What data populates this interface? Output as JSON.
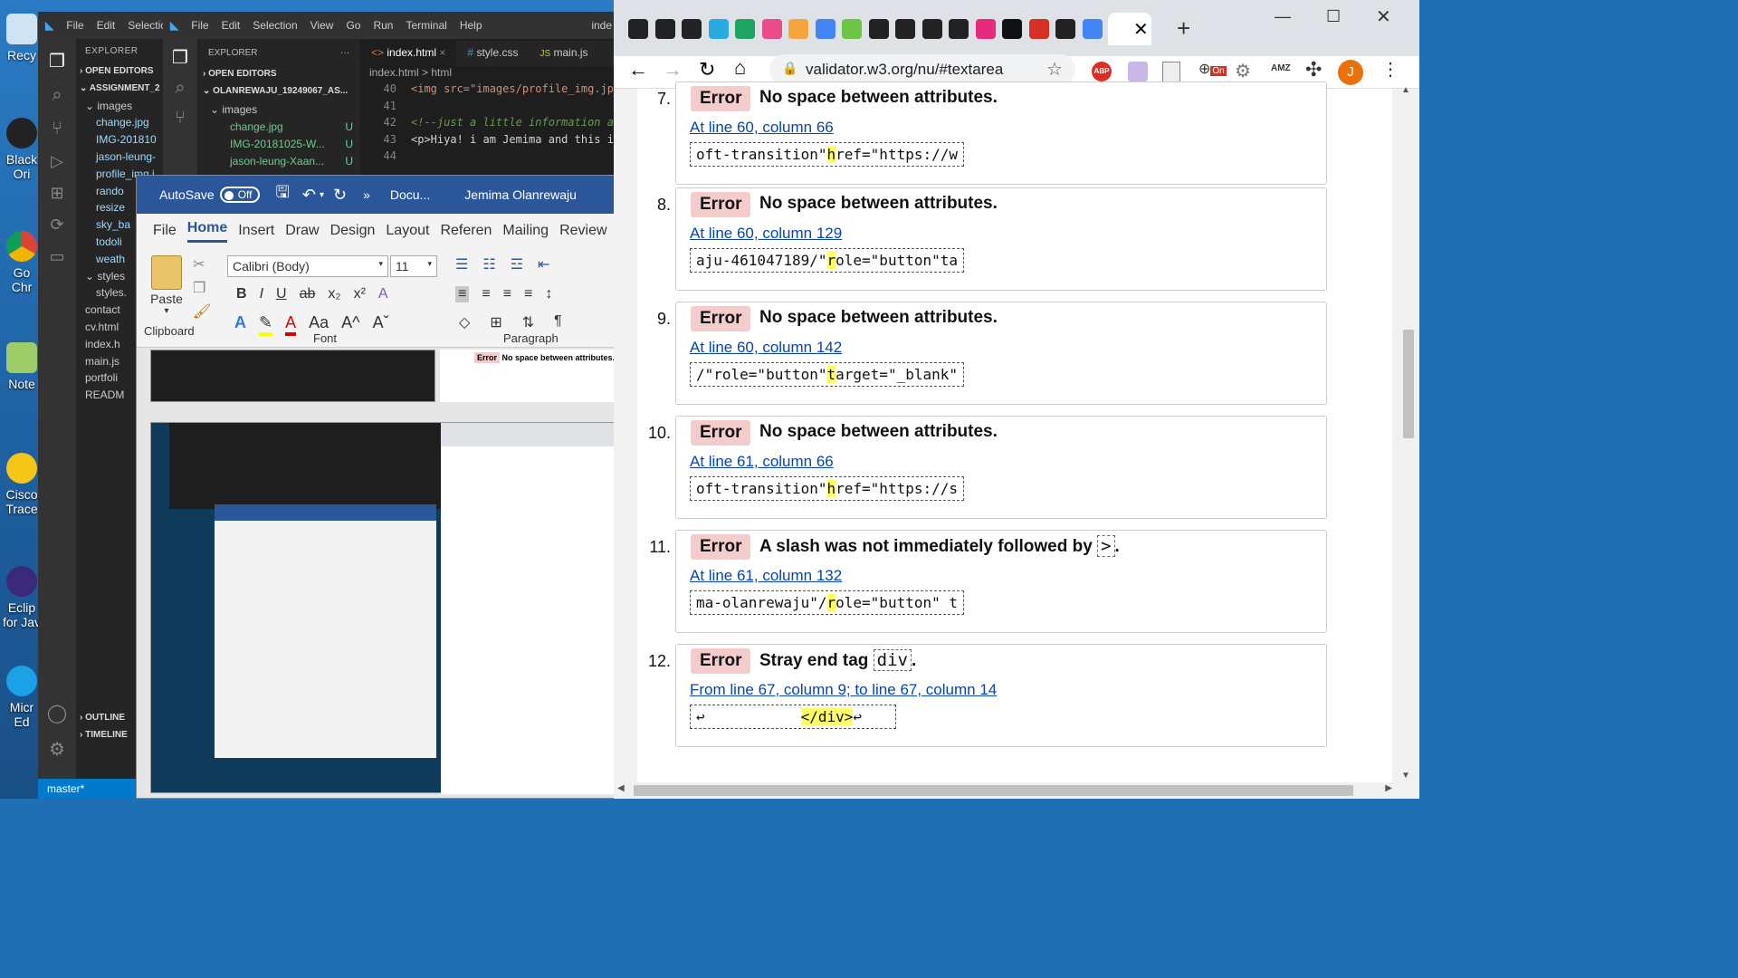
{
  "desktop": {
    "icons": [
      "Recy",
      "Black Ori",
      "Go Chr",
      "Note",
      "Cisco Trace",
      "Eclip for Jav",
      "Micr Ed"
    ]
  },
  "vscode_outer": {
    "menu": [
      "File",
      "Edit",
      "Selectio"
    ],
    "explorer_title": "EXPLORER",
    "open_editors": "OPEN EDITORS",
    "project": "ASSIGNMENT_2",
    "tree": [
      "images",
      "change.jpg",
      "IMG-201810",
      "jason-leung-",
      "profile_img.j",
      "rando",
      "resize",
      "sky_ba",
      "todoli",
      "weath",
      "styles",
      "styles.",
      "contact",
      "cv.html",
      "index.h",
      "main.js",
      "portfoli",
      "READM"
    ],
    "outline": "OUTLINE",
    "timeline": "TIMELINE",
    "branch": "master*"
  },
  "vscode_inner": {
    "menu": [
      "File",
      "Edit",
      "Selection",
      "View",
      "Go",
      "Run",
      "Terminal",
      "Help"
    ],
    "title_right": "inde",
    "explorer_title": "EXPLORER",
    "open_editors": "OPEN EDITORS",
    "project": "OLANREWAJU_19249067_AS...",
    "tree": [
      "images",
      "change.jpg",
      "IMG-20181025-W...",
      "jason-leung-Xaan..."
    ],
    "tabs": [
      "index.html",
      "style.css",
      "main.js"
    ],
    "breadcrumb": "index.html > html",
    "lines": [
      {
        "n": "40",
        "t": "<img src=\"images/profile_img.jp"
      },
      {
        "n": "41",
        "t": ""
      },
      {
        "n": "42",
        "t": "<!--just a little information a"
      },
      {
        "n": "43",
        "t": "<p>Hiya! i am Jemima and this is"
      },
      {
        "n": "44",
        "t": ""
      }
    ]
  },
  "word": {
    "autosave": "AutoSave",
    "toggle": "Off",
    "doc_title": "Docu...",
    "user": "Jemima Olanrewaju",
    "tabs": [
      "File",
      "Home",
      "Insert",
      "Draw",
      "Design",
      "Layout",
      "Referen",
      "Mailing",
      "Review"
    ],
    "paste": "Paste",
    "font_name": "Calibri (Body)",
    "font_size": "11",
    "group_clipboard": "Clipboard",
    "group_font": "Font",
    "group_paragraph": "Paragraph"
  },
  "chrome": {
    "url": "validator.w3.org/nu/#textarea",
    "profile_initial": "J",
    "abp": "ABP",
    "amz": "AMZ",
    "on_badge": "On",
    "new_tab": "+"
  },
  "errors": [
    {
      "num": "7.",
      "type": "Error",
      "msg": "No space between attributes.",
      "loc": "At line 60, column 66",
      "pre": "oft-transition\"",
      "hl": "h",
      "post": "ref=\"https://w"
    },
    {
      "num": "8.",
      "type": "Error",
      "msg": "No space between attributes.",
      "loc": "At line 60, column 129",
      "pre": "aju-461047189/\"",
      "hl": "r",
      "post": "ole=\"button\"ta"
    },
    {
      "num": "9.",
      "type": "Error",
      "msg": "No space between attributes.",
      "loc": "At line 60, column 142",
      "pre": "/\"role=\"button\"",
      "hl": "t",
      "post": "arget=\"_blank\""
    },
    {
      "num": "10.",
      "type": "Error",
      "msg": "No space between attributes.",
      "loc": "At line 61, column 66",
      "pre": "oft-transition\"",
      "hl": "h",
      "post": "ref=\"https://s"
    },
    {
      "num": "11.",
      "type": "Error",
      "msg": "A slash was not immediately followed by",
      "msg_code": ">",
      "msg_end": ".",
      "loc": "At line 61, column 132",
      "pre": "ma-olanrewaju\"/",
      "hl": "r",
      "post": "ole=\"button\" t"
    },
    {
      "num": "12.",
      "type": "Error",
      "msg": "Stray end tag",
      "msg_code": "div",
      "msg_end": ".",
      "loc": "From line 67, column 9; to line 67, column 14",
      "pre": "↩           ",
      "hl": "</div>",
      "post": "↩"
    }
  ]
}
